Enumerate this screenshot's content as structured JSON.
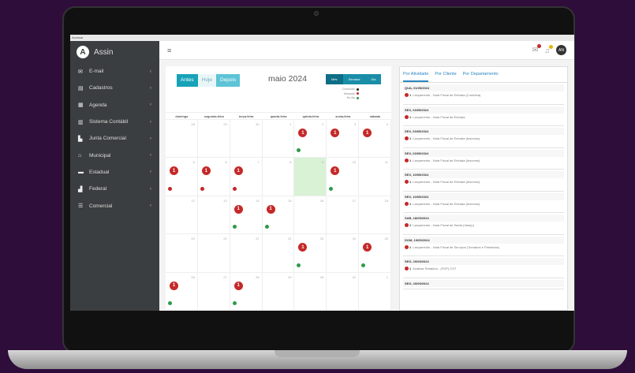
{
  "browser": {
    "tab_label": "Acessar"
  },
  "app": {
    "name": "Assin",
    "logo_letter": "A"
  },
  "sidebar": {
    "items": [
      {
        "label": "E-mail",
        "icon": "envelope-icon",
        "glyph": "✉"
      },
      {
        "label": "Cadastros",
        "icon": "document-icon",
        "glyph": "▤"
      },
      {
        "label": "Agenda",
        "icon": "calendar-icon",
        "glyph": "▦"
      },
      {
        "label": "Sistema Contábil",
        "icon": "book-icon",
        "glyph": "▥"
      },
      {
        "label": "Junta Comercial",
        "icon": "building-icon",
        "glyph": "▙"
      },
      {
        "label": "Municipal",
        "icon": "bank-icon",
        "glyph": "⌂"
      },
      {
        "label": "Estadual",
        "icon": "card-icon",
        "glyph": "▬"
      },
      {
        "label": "Federal",
        "icon": "institution-icon",
        "glyph": "▟"
      },
      {
        "label": "Comercial",
        "icon": "list-icon",
        "glyph": "☰"
      }
    ]
  },
  "topbar": {
    "avatar_initials": "AN",
    "menu_glyph": "≡",
    "mail_glyph": "✉",
    "bell_glyph": "♫"
  },
  "calendar": {
    "nav": {
      "prev": "Antes",
      "current": "Hoje",
      "next": "Depois"
    },
    "title": "maio 2024",
    "views": [
      "Mês",
      "Semana",
      "Dia"
    ],
    "legend": [
      {
        "label": "Concluído",
        "color": "#222222"
      },
      {
        "label": "Atrasado",
        "color": "#c62828"
      },
      {
        "label": "No dia",
        "color": "#2e9b4a"
      }
    ],
    "weekdays": [
      "domingo",
      "segunda-feira",
      "terça-feira",
      "quarta-feira",
      "quinta-feira",
      "sexta-feira",
      "sábado"
    ],
    "cells": [
      {
        "day": "28",
        "event": "",
        "dot": ""
      },
      {
        "day": "29",
        "event": "",
        "dot": ""
      },
      {
        "day": "30",
        "event": "",
        "dot": ""
      },
      {
        "day": "1",
        "event": "",
        "dot": ""
      },
      {
        "day": "2",
        "event": "1",
        "dot": "#2e9b4a"
      },
      {
        "day": "3",
        "event": "1",
        "dot": ""
      },
      {
        "day": "4",
        "event": "1",
        "dot": ""
      },
      {
        "day": "5",
        "event": "1",
        "dot": "#c62828"
      },
      {
        "day": "6",
        "event": "1",
        "dot": "#c62828"
      },
      {
        "day": "7",
        "event": "1",
        "dot": "#c62828"
      },
      {
        "day": "8",
        "event": "",
        "dot": ""
      },
      {
        "day": "9",
        "event": "",
        "dot": "",
        "today": true
      },
      {
        "day": "10",
        "event": "1",
        "dot": "#2e9b4a"
      },
      {
        "day": "11",
        "event": "",
        "dot": ""
      },
      {
        "day": "12",
        "event": "",
        "dot": ""
      },
      {
        "day": "13",
        "event": "",
        "dot": ""
      },
      {
        "day": "14",
        "event": "1",
        "dot": "#2e9b4a"
      },
      {
        "day": "15",
        "event": "1",
        "dot": "#2e9b4a"
      },
      {
        "day": "16",
        "event": "",
        "dot": ""
      },
      {
        "day": "17",
        "event": "",
        "dot": ""
      },
      {
        "day": "18",
        "event": "",
        "dot": ""
      },
      {
        "day": "19",
        "event": "",
        "dot": ""
      },
      {
        "day": "20",
        "event": "",
        "dot": ""
      },
      {
        "day": "21",
        "event": "",
        "dot": ""
      },
      {
        "day": "22",
        "event": "",
        "dot": ""
      },
      {
        "day": "23",
        "event": "1",
        "dot": "#2e9b4a"
      },
      {
        "day": "24",
        "event": "",
        "dot": ""
      },
      {
        "day": "25",
        "event": "1",
        "dot": "#2e9b4a"
      },
      {
        "day": "26",
        "event": "1",
        "dot": "#2e9b4a"
      },
      {
        "day": "27",
        "event": "",
        "dot": ""
      },
      {
        "day": "28",
        "event": "1",
        "dot": "#2e9b4a"
      },
      {
        "day": "29",
        "event": "",
        "dot": ""
      },
      {
        "day": "30",
        "event": "",
        "dot": ""
      },
      {
        "day": "31",
        "event": "",
        "dot": ""
      },
      {
        "day": "1",
        "event": "",
        "dot": ""
      }
    ]
  },
  "list": {
    "tabs": [
      "Por Atividade",
      "Por Cliente",
      "Por Departamento"
    ],
    "entries": [
      {
        "date": "QUA, 01/05/2024",
        "count": "1",
        "text": "Lançamento - Nota Fiscal de Entrada (Combina)"
      },
      {
        "date": "SEX, 03/05/2024",
        "count": "1",
        "text": "Lançamento - Nota Fiscal de Entrada"
      },
      {
        "date": "SEX, 03/05/2024",
        "count": "1",
        "text": "Lançamento - Nota Fiscal de Entrada (Insumos)"
      },
      {
        "date": "SEX, 03/05/2024",
        "count": "1",
        "text": "Lançamento - Nota Fiscal de Entrada (Insumos)"
      },
      {
        "date": "SEX, 10/05/2024",
        "count": "1",
        "text": "Lançamento - Nota Fiscal de Entrada (Insumos)"
      },
      {
        "date": "SEX, 10/05/2024",
        "count": "1",
        "text": "Lançamento - Nota Fiscal de Entrada (Insumos)"
      },
      {
        "date": "SAB, 18/05/2024",
        "count": "1",
        "text": "Lançamento - Nota Fiscal de Saída (Varejo)"
      },
      {
        "date": "DOM, 19/05/2024",
        "count": "1",
        "text": "Lançamento - Nota Fiscal de Serviços (Tomados e Prestados)"
      },
      {
        "date": "SEG, 20/05/2024",
        "count": "1",
        "text": "Analisar Relatório - (FOP) CST"
      },
      {
        "date": "SEG, 20/05/2024",
        "count": "",
        "text": ""
      }
    ]
  },
  "colors": {
    "accent": "#17a2b8",
    "alert": "#c62828",
    "ok": "#2e9b4a",
    "sidebar": "#3b3e40"
  }
}
